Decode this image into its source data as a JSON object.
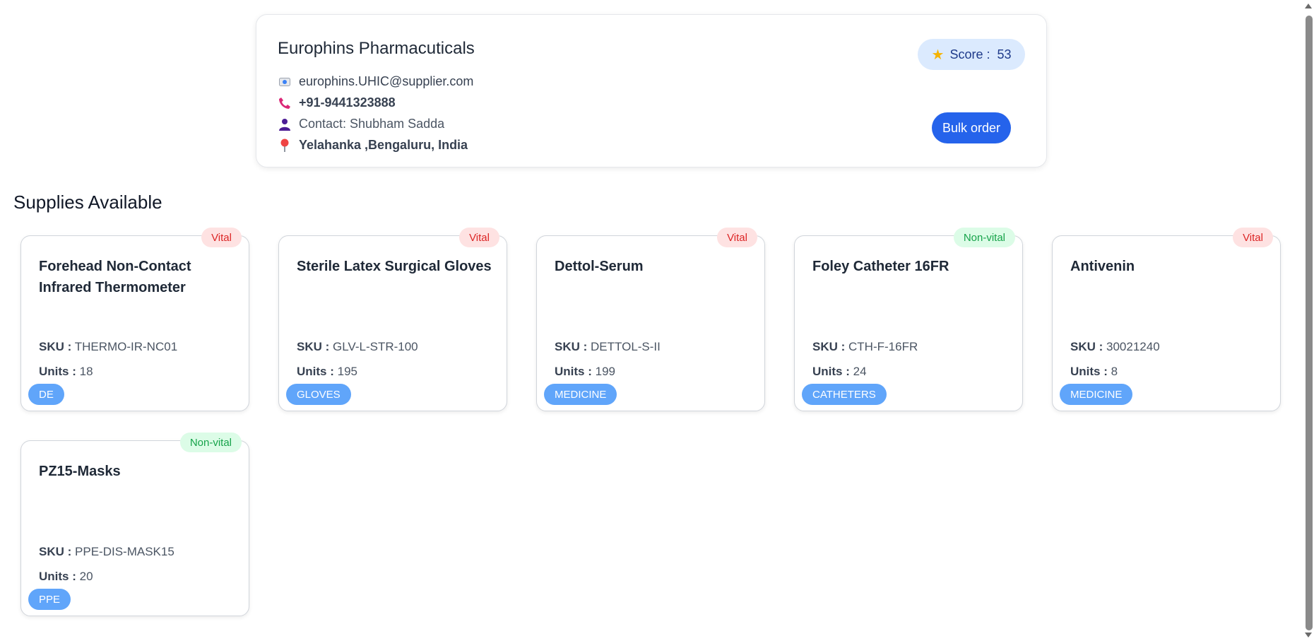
{
  "supplier": {
    "name": "Europhins Pharmacuticals",
    "email": "europhins.UHIC@supplier.com",
    "phone": "+91-9441323888",
    "contact": "Contact: Shubham Sadda",
    "location": "Yelahanka ,Bengaluru, India",
    "score_label": "Score :",
    "score_value": "53",
    "bulk_order_label": "Bulk order"
  },
  "section_title": "Supplies Available",
  "labels": {
    "sku": "SKU :",
    "units": "Units :"
  },
  "items": [
    {
      "name": "Forehead Non-Contact Infrared Thermometer",
      "sku": "THERMO-IR-NC01",
      "units": "18",
      "category": "DE",
      "badge": "Vital"
    },
    {
      "name": "Sterile Latex Surgical Gloves",
      "sku": "GLV-L-STR-100",
      "units": "195",
      "category": "GLOVES",
      "badge": "Vital"
    },
    {
      "name": "Dettol-Serum",
      "sku": "DETTOL-S-II",
      "units": "199",
      "category": "MEDICINE",
      "badge": "Vital"
    },
    {
      "name": "Foley Catheter 16FR",
      "sku": "CTH-F-16FR",
      "units": "24",
      "category": "CATHETERS",
      "badge": "Non-vital"
    },
    {
      "name": "Antivenin",
      "sku": "30021240",
      "units": "8",
      "category": "MEDICINE",
      "badge": "Vital"
    },
    {
      "name": "PZ15-Masks",
      "sku": "PPE-DIS-MASK15",
      "units": "20",
      "category": "PPE",
      "badge": "Non-vital"
    }
  ],
  "colors": {
    "accent": "#2563eb",
    "tag": "#60a5fa",
    "vital_bg": "#fee2e2",
    "vital_fg": "#dc2626",
    "nonvital_bg": "#dcfce7",
    "nonvital_fg": "#16a34a"
  },
  "icons": {
    "email": "id-card-icon",
    "phone": "phone-icon",
    "contact": "person-icon",
    "location": "pin-icon",
    "score": "star-icon"
  }
}
